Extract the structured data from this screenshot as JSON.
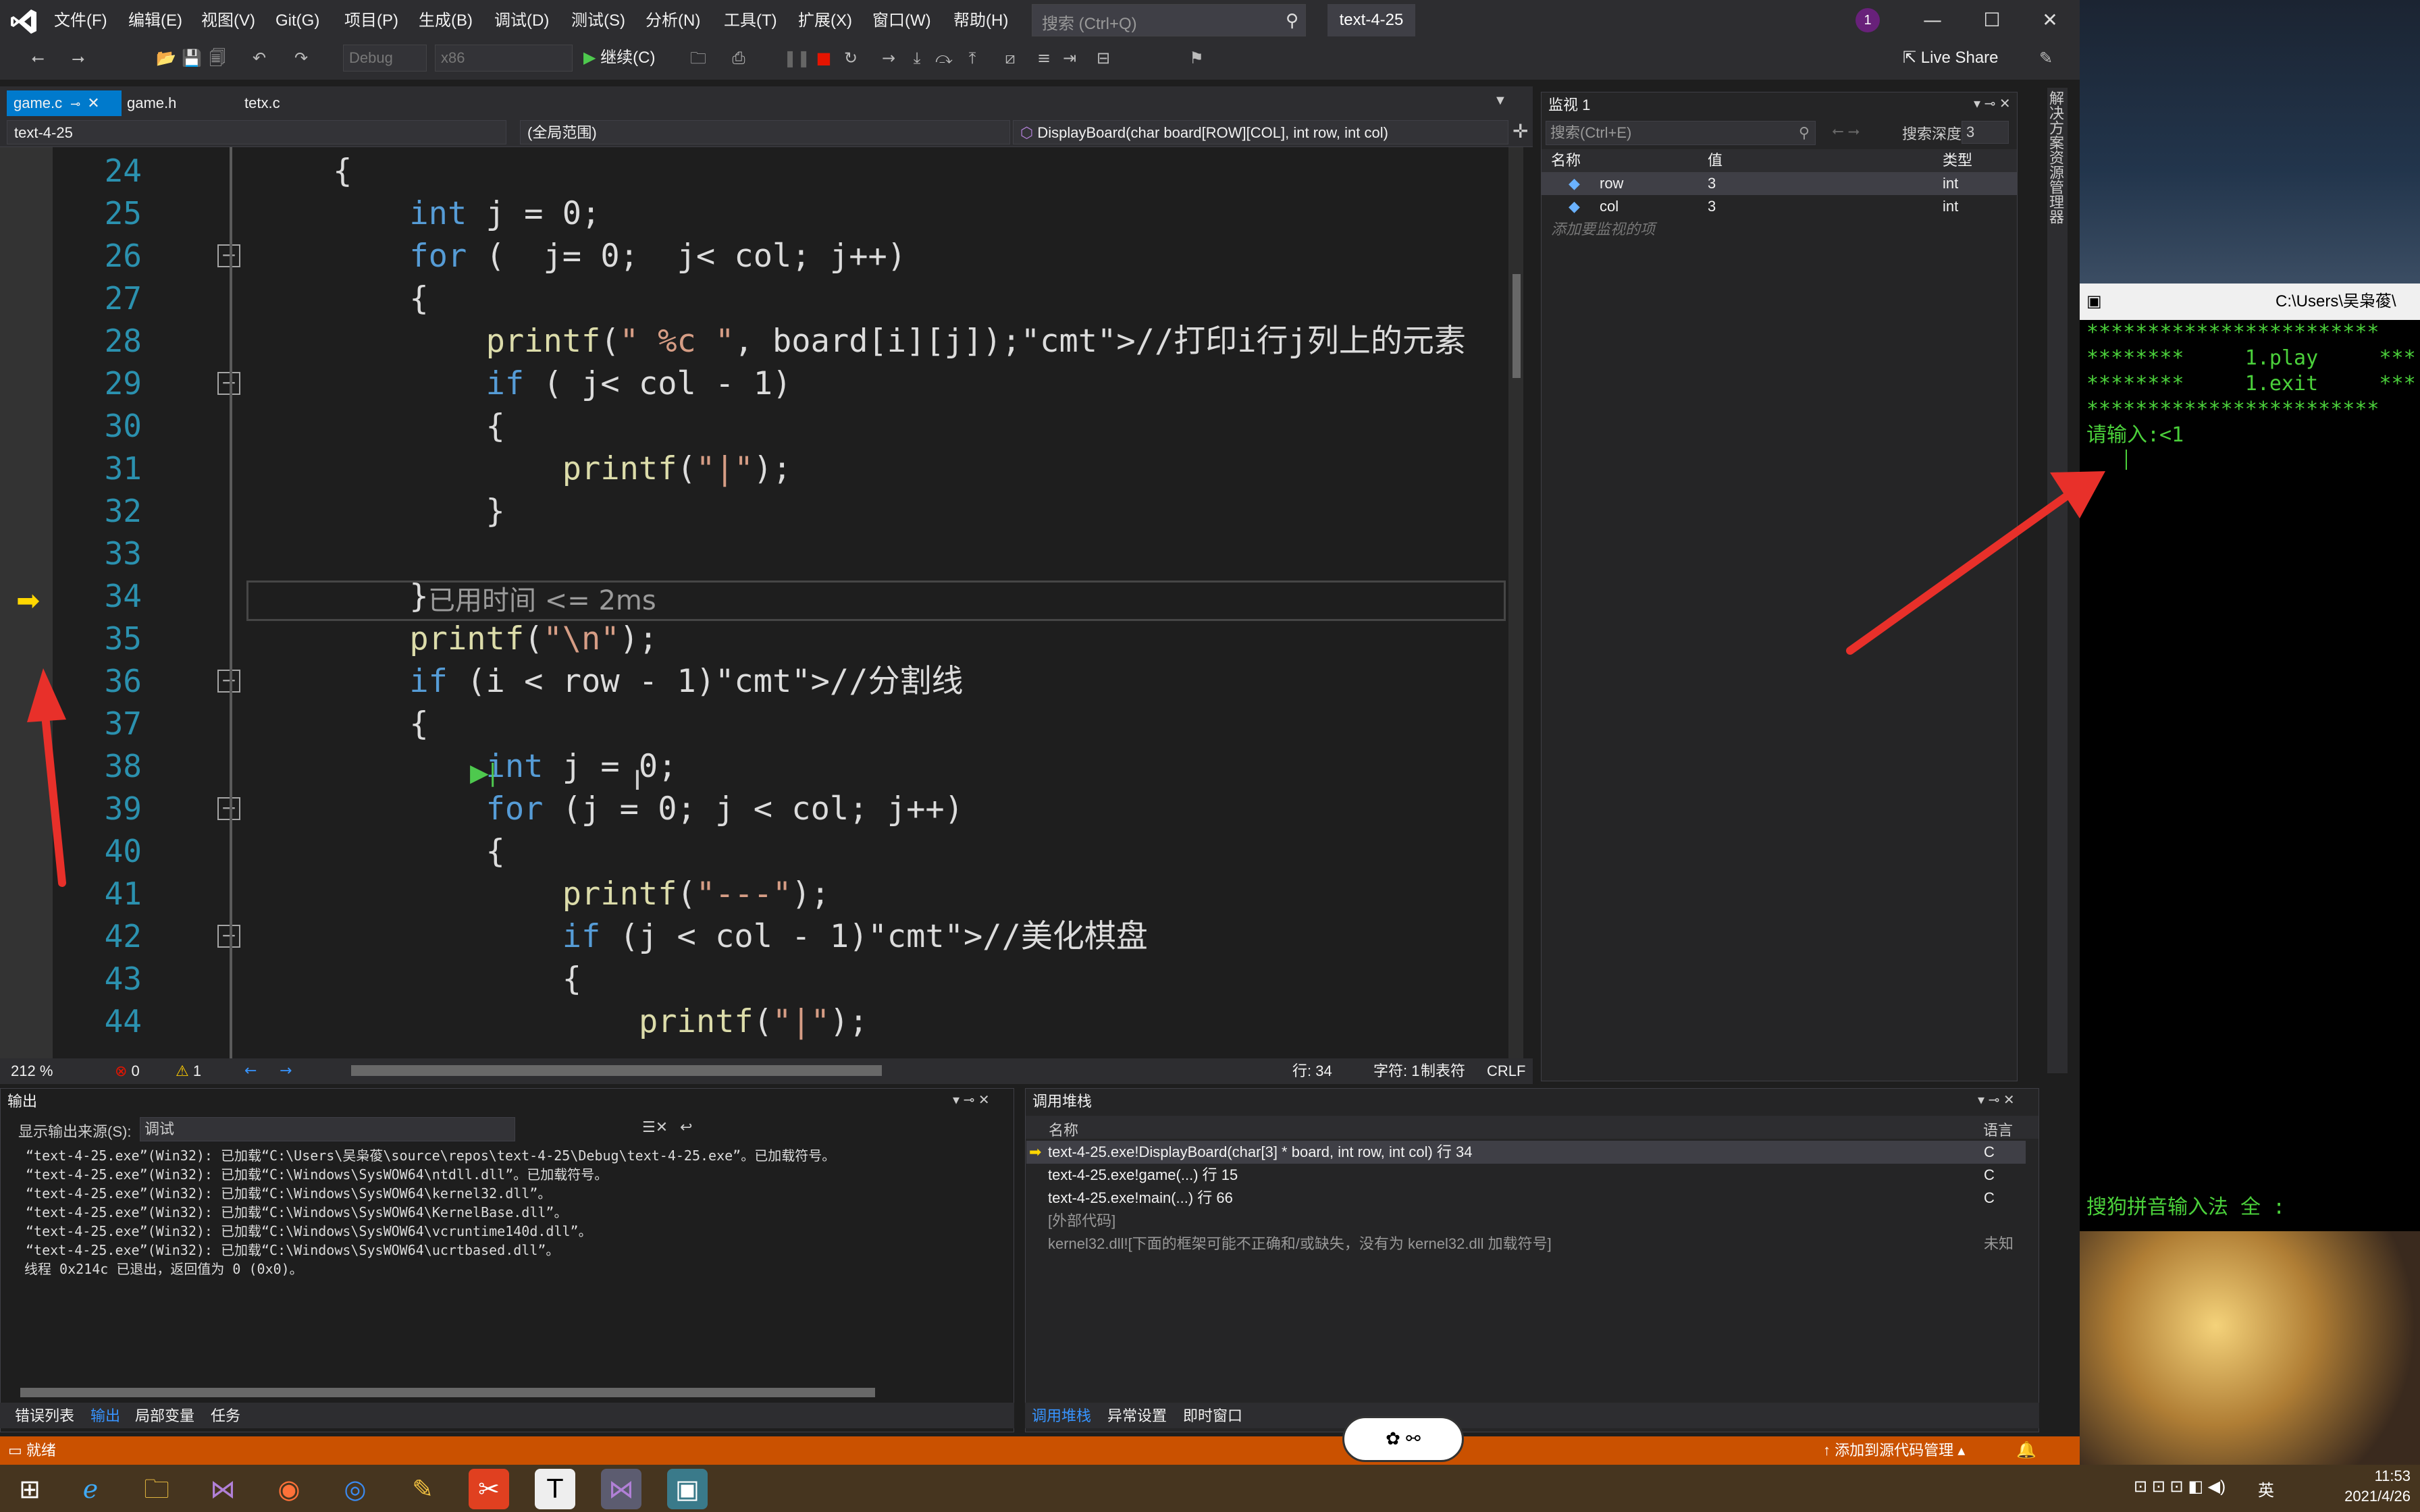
{
  "menu": [
    "文件(F)",
    "编辑(E)",
    "视图(V)",
    "Git(G)",
    "项目(P)",
    "生成(B)",
    "调试(D)",
    "测试(S)",
    "分析(N)",
    "工具(T)",
    "扩展(X)",
    "窗口(W)",
    "帮助(H)"
  ],
  "search_placeholder": "搜索 (Ctrl+Q)",
  "project_title": "text-4-25",
  "notification_count": "1",
  "toolbar": {
    "config": "Debug",
    "platform": "x86",
    "continue": "继续(C)",
    "live_share": "Live Share"
  },
  "tabs": [
    "game.c",
    "game.h",
    "tetx.c"
  ],
  "nav": {
    "project": "text-4-25",
    "scope": "(全局范围)",
    "function": "DisplayBoard(char board[ROW][COL], int row, int col)"
  },
  "code_lines": [
    {
      "n": "24",
      "indent": "    ",
      "text": "{"
    },
    {
      "n": "25",
      "indent": "        ",
      "text": "int j = 0;"
    },
    {
      "n": "26",
      "indent": "        ",
      "text": "for (  j= 0;  j< col; j++)"
    },
    {
      "n": "27",
      "indent": "        ",
      "text": "{"
    },
    {
      "n": "28",
      "indent": "            ",
      "text": "printf(\" %c \", board[i][j]);//打印i行j列上的元素"
    },
    {
      "n": "29",
      "indent": "            ",
      "text": "if ( j< col - 1)"
    },
    {
      "n": "30",
      "indent": "            ",
      "text": "{"
    },
    {
      "n": "31",
      "indent": "                ",
      "text": "printf(\"|\");"
    },
    {
      "n": "32",
      "indent": "            ",
      "text": "}"
    },
    {
      "n": "33",
      "indent": "",
      "text": ""
    },
    {
      "n": "34",
      "indent": "        ",
      "text": "}"
    },
    {
      "n": "35",
      "indent": "        ",
      "text": "printf(\"\\n\");"
    },
    {
      "n": "36",
      "indent": "        ",
      "text": "if (i < row - 1)//分割线"
    },
    {
      "n": "37",
      "indent": "        ",
      "text": "{"
    },
    {
      "n": "38",
      "indent": "            ",
      "text": "int j = 0;"
    },
    {
      "n": "39",
      "indent": "            ",
      "text": "for (j = 0; j < col; j++)"
    },
    {
      "n": "40",
      "indent": "            ",
      "text": "{"
    },
    {
      "n": "41",
      "indent": "                ",
      "text": "printf(\"---\");"
    },
    {
      "n": "42",
      "indent": "                ",
      "text": "if (j < col - 1)//美化棋盘"
    },
    {
      "n": "43",
      "indent": "                ",
      "text": "{"
    },
    {
      "n": "44",
      "indent": "                    ",
      "text": "printf(\"|\");"
    }
  ],
  "elapsed_hint": "已用时间 <= 2ms",
  "editor_status": {
    "zoom": "212 %",
    "errors": "0",
    "warnings": "1",
    "line": "行: 34",
    "char": "字符: 1",
    "tabs": "制表符",
    "eol": "CRLF"
  },
  "watch": {
    "title": "监视 1",
    "search_placeholder": "搜索(Ctrl+E)",
    "depth_label": "搜索深度:",
    "depth_value": "3",
    "headers": [
      "名称",
      "值",
      "类型"
    ],
    "rows": [
      {
        "name": "row",
        "value": "3",
        "type": "int"
      },
      {
        "name": "col",
        "value": "3",
        "type": "int"
      }
    ],
    "add_hint": "添加要监视的项"
  },
  "solution_explorer_label": "解决方案资源管理器",
  "output": {
    "title": "输出",
    "source_label": "显示输出来源(S):",
    "source_value": "调试",
    "lines": [
      "“text-4-25.exe”(Win32): 已加载“C:\\Users\\吴枭葰\\source\\repos\\text-4-25\\Debug\\text-4-25.exe”。已加载符号。",
      "“text-4-25.exe”(Win32): 已加载“C:\\Windows\\SysWOW64\\ntdll.dll”。已加载符号。",
      "“text-4-25.exe”(Win32): 已加载“C:\\Windows\\SysWOW64\\kernel32.dll”。",
      "“text-4-25.exe”(Win32): 已加载“C:\\Windows\\SysWOW64\\KernelBase.dll”。",
      "“text-4-25.exe”(Win32): 已加载“C:\\Windows\\SysWOW64\\vcruntime140d.dll”。",
      "“text-4-25.exe”(Win32): 已加载“C:\\Windows\\SysWOW64\\ucrtbased.dll”。",
      "线程 0x214c 已退出，返回值为 0 (0x0)。"
    ],
    "tabs": [
      "错误列表",
      "输出",
      "局部变量",
      "任务"
    ]
  },
  "callstack": {
    "title": "调用堆栈",
    "headers": [
      "名称",
      "语言"
    ],
    "rows": [
      {
        "name": "text-4-25.exe!DisplayBoard(char[3] * board, int row, int col) 行 34",
        "lang": "C"
      },
      {
        "name": "text-4-25.exe!game(...) 行 15",
        "lang": "C"
      },
      {
        "name": "text-4-25.exe!main(...) 行 66",
        "lang": "C"
      },
      {
        "name": "[外部代码]",
        "lang": ""
      },
      {
        "name": "kernel32.dll![下面的框架可能不正确和/或缺失，没有为 kernel32.dll 加载符号]",
        "lang": "未知"
      }
    ],
    "tabs": [
      "调用堆栈",
      "异常设置",
      "即时窗口"
    ]
  },
  "statusbar": {
    "ready": "就绪",
    "source_control": "添加到源代码管理"
  },
  "console": {
    "title": "C:\\Users\\吴枭葰\\",
    "lines": [
      "************************",
      "********     1.play     ***",
      "********     1.exit     ***",
      "************************",
      "请输入:<1"
    ],
    "ime": "搜狗拼音输入法 全 :"
  },
  "taskbar": {
    "time": "11:53",
    "date": "2021/4/26",
    "lang": "英"
  },
  "colors": {
    "accent": "#007acc",
    "status": "#ca5100",
    "console_text": "#4bd13b",
    "annotation_arrow": "#e8302a"
  }
}
